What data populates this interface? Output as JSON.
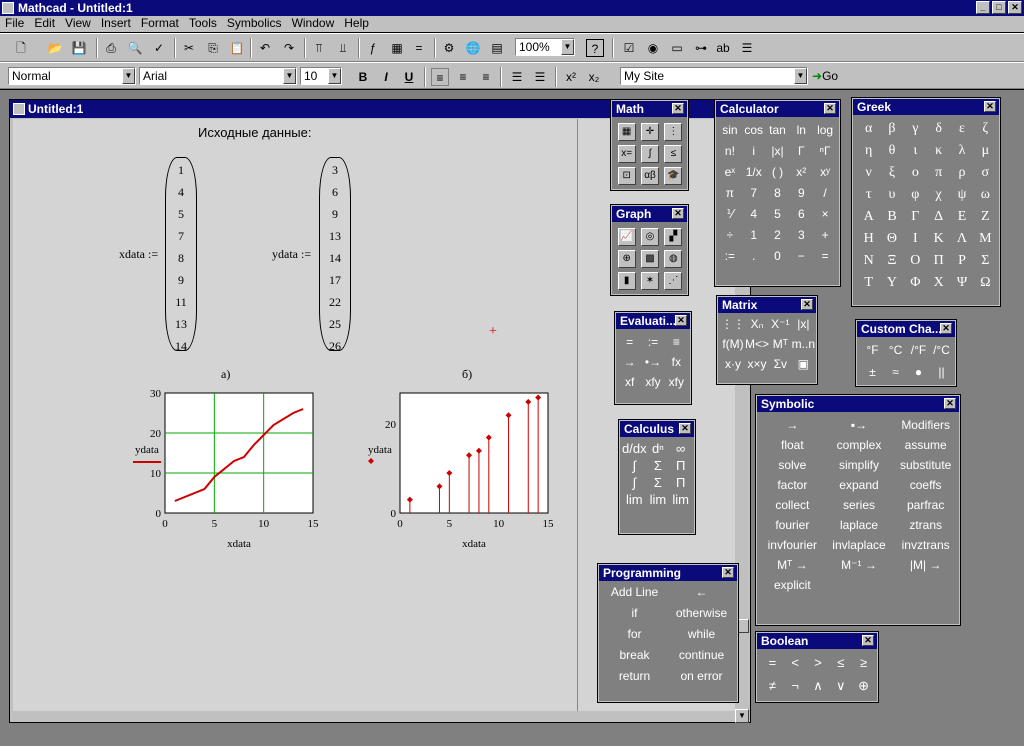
{
  "app": {
    "title": "Mathcad - Untitled:1",
    "min": "_",
    "max": "□",
    "close": "✕"
  },
  "menu": [
    "File",
    "Edit",
    "View",
    "Insert",
    "Format",
    "Tools",
    "Symbolics",
    "Window",
    "Help"
  ],
  "toolbar": {
    "zoom": "100%",
    "question": "?"
  },
  "format": {
    "style": "Normal",
    "font": "Arial",
    "size": "10",
    "bold": "B",
    "italic": "I",
    "underline": "U",
    "site": "My Site",
    "go": "Go"
  },
  "doc": {
    "title": "Untitled:1",
    "heading": "Исходные данные:",
    "xdata_label": "xdata :=",
    "ydata_label": "ydata :=",
    "xdata": [
      "1",
      "4",
      "5",
      "7",
      "8",
      "9",
      "11",
      "13",
      "14"
    ],
    "ydata": [
      "3",
      "6",
      "9",
      "13",
      "14",
      "17",
      "22",
      "25",
      "26"
    ],
    "cap_a": "а)",
    "cap_b": "б)"
  },
  "chart_data": [
    {
      "type": "line",
      "x": [
        1,
        4,
        5,
        7,
        8,
        9,
        11,
        13,
        14
      ],
      "y": [
        3,
        6,
        9,
        13,
        14,
        17,
        22,
        25,
        26
      ],
      "xlabel": "xdata",
      "ylabel": "ydata",
      "xlim": [
        0,
        15
      ],
      "ylim": [
        0,
        30
      ],
      "xticks": [
        "0",
        "5",
        "10",
        "15"
      ],
      "yticks": [
        "0",
        "10",
        "20",
        "30"
      ],
      "grid": true,
      "color": "#cc0000",
      "grid_color": "#00aa00"
    },
    {
      "type": "stem",
      "x": [
        1,
        4,
        5,
        7,
        8,
        9,
        11,
        13,
        14
      ],
      "y": [
        3,
        6,
        9,
        13,
        14,
        17,
        22,
        25,
        26
      ],
      "xlabel": "xdata",
      "ylabel": "ydata",
      "xlim": [
        0,
        15
      ],
      "ylim": [
        0,
        27
      ],
      "xticks": [
        "0",
        "5",
        "10",
        "15"
      ],
      "yticks": [
        "0",
        "20"
      ],
      "grid": false,
      "color": "#cc0000"
    }
  ],
  "palettes": {
    "math": {
      "title": "Math"
    },
    "graph": {
      "title": "Graph"
    },
    "evaluation": {
      "title": "Evaluati...",
      "items": [
        "=",
        ":=",
        "≡",
        "→",
        "•→",
        "fx",
        "xf",
        "xfy",
        "xfy"
      ]
    },
    "calculus": {
      "title": "Calculus"
    },
    "programming": {
      "title": "Programming",
      "items": [
        "Add Line",
        "←",
        "if",
        "otherwise",
        "for",
        "while",
        "break",
        "continue",
        "return",
        "on error"
      ]
    },
    "calculator": {
      "title": "Calculator",
      "items": [
        "sin",
        "cos",
        "tan",
        "ln",
        "log",
        "n!",
        "i",
        "|x|",
        "Γ",
        "ⁿΓ",
        "eˣ",
        "1/x",
        "( )",
        "x²",
        "xʸ",
        "π",
        "7",
        "8",
        "9",
        "/",
        "⅟",
        "4",
        "5",
        "6",
        "×",
        "÷",
        "1",
        "2",
        "3",
        "+",
        ":=",
        ".",
        "0",
        "−",
        "="
      ]
    },
    "matrix": {
      "title": "Matrix"
    },
    "greek": {
      "title": "Greek",
      "items": [
        "α",
        "β",
        "γ",
        "δ",
        "ε",
        "ζ",
        "η",
        "θ",
        "ι",
        "κ",
        "λ",
        "μ",
        "ν",
        "ξ",
        "ο",
        "π",
        "ρ",
        "σ",
        "τ",
        "υ",
        "φ",
        "χ",
        "ψ",
        "ω",
        "Α",
        "Β",
        "Γ",
        "Δ",
        "Ε",
        "Ζ",
        "Η",
        "Θ",
        "Ι",
        "Κ",
        "Λ",
        "Μ",
        "Ν",
        "Ξ",
        "Ο",
        "Π",
        "Ρ",
        "Σ",
        "Τ",
        "Υ",
        "Φ",
        "Χ",
        "Ψ",
        "Ω"
      ]
    },
    "custom": {
      "title": "Custom Cha...",
      "items": [
        "°F",
        "°C",
        "/°F",
        "/°C",
        "±",
        "≈",
        "●",
        "||"
      ]
    },
    "symbolic": {
      "title": "Symbolic",
      "items": [
        "→",
        "▪→",
        "Modifiers",
        "float",
        "complex",
        "assume",
        "solve",
        "simplify",
        "substitute",
        "factor",
        "expand",
        "coeffs",
        "collect",
        "series",
        "parfrac",
        "fourier",
        "laplace",
        "ztrans",
        "invfourier",
        "invlaplace",
        "invztrans",
        "Mᵀ →",
        "M⁻¹ →",
        "|M| →",
        "explicit",
        "",
        ""
      ]
    },
    "boolean": {
      "title": "Boolean",
      "items": [
        "=",
        "<",
        ">",
        "≤",
        "≥",
        "≠",
        "¬",
        "∧",
        "∨",
        "⊕"
      ]
    }
  }
}
